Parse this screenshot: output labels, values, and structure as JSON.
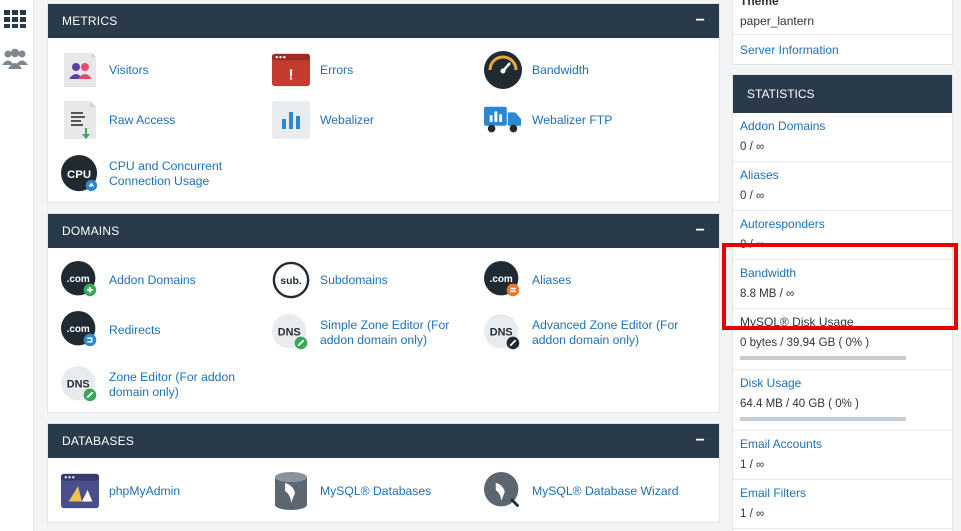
{
  "nav": {
    "apps_icon": "grid-icon",
    "users_icon": "users-icon"
  },
  "metrics": {
    "title": "METRICS",
    "collapse": "−",
    "items": [
      {
        "label": "Visitors",
        "icon": "visitors-icon"
      },
      {
        "label": "Errors",
        "icon": "errors-icon"
      },
      {
        "label": "Bandwidth",
        "icon": "bandwidth-icon"
      },
      {
        "label": "Raw Access",
        "icon": "raw-access-icon"
      },
      {
        "label": "Webalizer",
        "icon": "webalizer-icon"
      },
      {
        "label": "Webalizer FTP",
        "icon": "webalizer-ftp-icon"
      },
      {
        "label_line1": "CPU and Concurrent",
        "label_line2": "Connection Usage",
        "icon": "cpu-icon"
      }
    ]
  },
  "domains": {
    "title": "DOMAINS",
    "collapse": "−",
    "items": [
      {
        "label": "Addon Domains",
        "icon_text": ".com"
      },
      {
        "label": "Subdomains",
        "icon_text": "sub."
      },
      {
        "label": "Aliases",
        "icon_text": ".com"
      },
      {
        "label": "Redirects",
        "icon_text": ".com"
      },
      {
        "label_line1": "Simple Zone Editor (For",
        "label_line2": "addon domain only)",
        "icon_text": "DNS"
      },
      {
        "label_line1": "Advanced Zone Editor (For",
        "label_line2": "addon domain only)",
        "icon_text": "DNS"
      },
      {
        "label_line1": "Zone Editor (For addon",
        "label_line2": "domain only)",
        "icon_text": "DNS"
      }
    ]
  },
  "databases": {
    "title": "DATABASES",
    "collapse": "−",
    "items": [
      {
        "label": "phpMyAdmin",
        "icon": "phpmyadmin-icon"
      },
      {
        "label": "MySQL® Databases",
        "icon": "mysql-databases-icon"
      },
      {
        "label": "MySQL® Database Wizard",
        "icon": "mysql-wizard-icon"
      }
    ]
  },
  "general": {
    "theme_label": "Theme",
    "theme_value": "paper_lantern",
    "server_info": "Server Information"
  },
  "statistics": {
    "title": "STATISTICS",
    "rows": [
      {
        "name": "Addon Domains",
        "value": "0 / ∞"
      },
      {
        "name": "Aliases",
        "value": "0 / ∞"
      },
      {
        "name": "Autoresponders",
        "value": "0 / ∞"
      },
      {
        "name": "Bandwidth",
        "value": "8.8 MB / ∞"
      },
      {
        "name": "MySQL® Disk Usage",
        "value": "0 bytes / 39.94 GB ( 0% )",
        "percent": 0
      },
      {
        "name": "Disk Usage",
        "value": "64.4 MB / 40 GB ( 0% )",
        "percent": 0
      },
      {
        "name": "Email Accounts",
        "value": "1 / ∞"
      },
      {
        "name": "Email Filters",
        "value": "1 / ∞"
      }
    ]
  },
  "colors": {
    "header": "#293a4a",
    "link": "#1d70b8",
    "highlight": "#e60000"
  }
}
